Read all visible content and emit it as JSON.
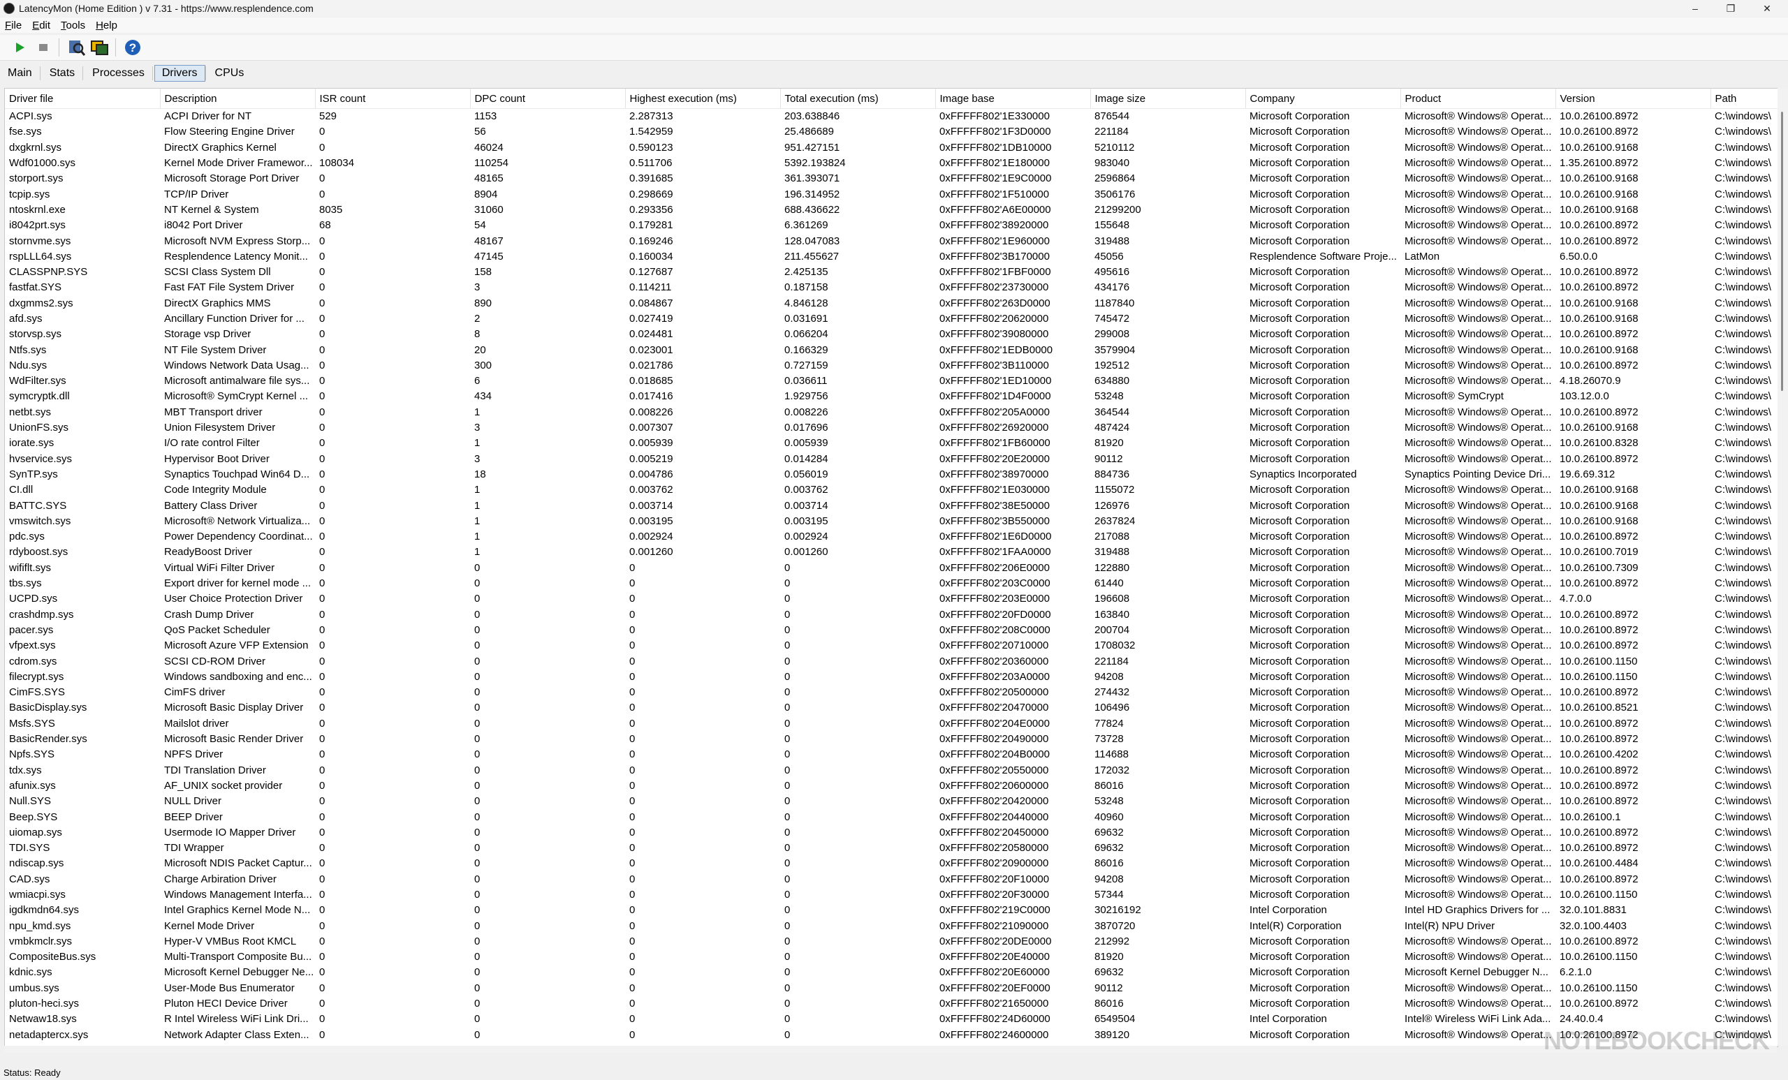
{
  "window": {
    "title": "LatencyMon  (Home Edition )  v 7.31 - https://www.resplendence.com",
    "minimize": "–",
    "maximize": "❐",
    "close": "✕"
  },
  "menu": [
    "File",
    "Edit",
    "Tools",
    "Help"
  ],
  "toolbar": {
    "buttons": [
      "play-icon",
      "stop-icon",
      "search-icon",
      "windows-icon",
      "help-icon"
    ],
    "colors": {
      "play": "#1aa32a",
      "stop": "#8a8a8a",
      "help": "#1f5fb8"
    }
  },
  "tabs": [
    "Main",
    "Stats",
    "Processes",
    "Drivers",
    "CPUs"
  ],
  "selected_tab": "Drivers",
  "columns": [
    "Driver file",
    "Description",
    "ISR count",
    "DPC count",
    "Highest execution (ms)",
    "Total execution (ms)",
    "Image base",
    "Image size",
    "Company",
    "Product",
    "Version",
    "Path"
  ],
  "rows": [
    [
      "ACPI.sys",
      "ACPI Driver for NT",
      "529",
      "1153",
      "2.287313",
      "203.638846",
      "0xFFFFF802'1E330000",
      "876544",
      "Microsoft Corporation",
      "Microsoft® Windows® Operat...",
      "10.0.26100.8972",
      "C:\\windows\\"
    ],
    [
      "fse.sys",
      "Flow Steering Engine Driver",
      "0",
      "56",
      "1.542959",
      "25.486689",
      "0xFFFFF802'1F3D0000",
      "221184",
      "Microsoft Corporation",
      "Microsoft® Windows® Operat...",
      "10.0.26100.8972",
      "C:\\windows\\"
    ],
    [
      "dxgkrnl.sys",
      "DirectX Graphics Kernel",
      "0",
      "46024",
      "0.590123",
      "951.427151",
      "0xFFFFF802'1DB10000",
      "5210112",
      "Microsoft Corporation",
      "Microsoft® Windows® Operat...",
      "10.0.26100.9168",
      "C:\\windows\\"
    ],
    [
      "Wdf01000.sys",
      "Kernel Mode Driver Framewor...",
      "108034",
      "110254",
      "0.511706",
      "5392.193824",
      "0xFFFFF802'1E180000",
      "983040",
      "Microsoft Corporation",
      "Microsoft® Windows® Operat...",
      "1.35.26100.8972",
      "C:\\windows\\"
    ],
    [
      "storport.sys",
      "Microsoft Storage Port Driver",
      "0",
      "48165",
      "0.391685",
      "361.393071",
      "0xFFFFF802'1E9C0000",
      "2596864",
      "Microsoft Corporation",
      "Microsoft® Windows® Operat...",
      "10.0.26100.9168",
      "C:\\windows\\"
    ],
    [
      "tcpip.sys",
      "TCP/IP Driver",
      "0",
      "8904",
      "0.298669",
      "196.314952",
      "0xFFFFF802'1F510000",
      "3506176",
      "Microsoft Corporation",
      "Microsoft® Windows® Operat...",
      "10.0.26100.9168",
      "C:\\windows\\"
    ],
    [
      "ntoskrnl.exe",
      "NT Kernel & System",
      "8035",
      "31060",
      "0.293356",
      "688.436622",
      "0xFFFFF802'A6E00000",
      "21299200",
      "Microsoft Corporation",
      "Microsoft® Windows® Operat...",
      "10.0.26100.9168",
      "C:\\windows\\"
    ],
    [
      "i8042prt.sys",
      "i8042 Port Driver",
      "68",
      "54",
      "0.179281",
      "6.361269",
      "0xFFFFF802'38920000",
      "155648",
      "Microsoft Corporation",
      "Microsoft® Windows® Operat...",
      "10.0.26100.8972",
      "C:\\windows\\"
    ],
    [
      "stornvme.sys",
      "Microsoft NVM Express Storp...",
      "0",
      "48167",
      "0.169246",
      "128.047083",
      "0xFFFFF802'1E960000",
      "319488",
      "Microsoft Corporation",
      "Microsoft® Windows® Operat...",
      "10.0.26100.8972",
      "C:\\windows\\"
    ],
    [
      "rspLLL64.sys",
      "Resplendence Latency Monit...",
      "0",
      "47145",
      "0.160034",
      "211.455627",
      "0xFFFFF802'3B170000",
      "45056",
      "Resplendence Software Proje...",
      "LatMon",
      "6.50.0.0",
      "C:\\windows\\"
    ],
    [
      "CLASSPNP.SYS",
      "SCSI Class System Dll",
      "0",
      "158",
      "0.127687",
      "2.425135",
      "0xFFFFF802'1FBF0000",
      "495616",
      "Microsoft Corporation",
      "Microsoft® Windows® Operat...",
      "10.0.26100.8972",
      "C:\\windows\\"
    ],
    [
      "fastfat.SYS",
      "Fast FAT File System Driver",
      "0",
      "3",
      "0.114211",
      "0.187158",
      "0xFFFFF802'23730000",
      "434176",
      "Microsoft Corporation",
      "Microsoft® Windows® Operat...",
      "10.0.26100.8972",
      "C:\\windows\\"
    ],
    [
      "dxgmms2.sys",
      "DirectX Graphics MMS",
      "0",
      "890",
      "0.084867",
      "4.846128",
      "0xFFFFF802'263D0000",
      "1187840",
      "Microsoft Corporation",
      "Microsoft® Windows® Operat...",
      "10.0.26100.9168",
      "C:\\windows\\"
    ],
    [
      "afd.sys",
      "Ancillary Function Driver for ...",
      "0",
      "2",
      "0.027419",
      "0.031691",
      "0xFFFFF802'20620000",
      "745472",
      "Microsoft Corporation",
      "Microsoft® Windows® Operat...",
      "10.0.26100.9168",
      "C:\\windows\\"
    ],
    [
      "storvsp.sys",
      "Storage vsp Driver",
      "0",
      "8",
      "0.024481",
      "0.066204",
      "0xFFFFF802'39080000",
      "299008",
      "Microsoft Corporation",
      "Microsoft® Windows® Operat...",
      "10.0.26100.8972",
      "C:\\windows\\"
    ],
    [
      "Ntfs.sys",
      "NT File System Driver",
      "0",
      "20",
      "0.023001",
      "0.166329",
      "0xFFFFF802'1EDB0000",
      "3579904",
      "Microsoft Corporation",
      "Microsoft® Windows® Operat...",
      "10.0.26100.9168",
      "C:\\windows\\"
    ],
    [
      "Ndu.sys",
      "Windows Network Data Usag...",
      "0",
      "300",
      "0.021786",
      "0.727159",
      "0xFFFFF802'3B110000",
      "192512",
      "Microsoft Corporation",
      "Microsoft® Windows® Operat...",
      "10.0.26100.8972",
      "C:\\windows\\"
    ],
    [
      "WdFilter.sys",
      "Microsoft antimalware file sys...",
      "0",
      "6",
      "0.018685",
      "0.036611",
      "0xFFFFF802'1ED10000",
      "634880",
      "Microsoft Corporation",
      "Microsoft® Windows® Operat...",
      "4.18.26070.9",
      "C:\\windows\\"
    ],
    [
      "symcryptk.dll",
      "Microsoft® SymCrypt Kernel ...",
      "0",
      "434",
      "0.017416",
      "1.929756",
      "0xFFFFF802'1D4F0000",
      "53248",
      "Microsoft Corporation",
      "Microsoft® SymCrypt",
      "103.12.0.0",
      "C:\\windows\\"
    ],
    [
      "netbt.sys",
      "MBT Transport driver",
      "0",
      "1",
      "0.008226",
      "0.008226",
      "0xFFFFF802'205A0000",
      "364544",
      "Microsoft Corporation",
      "Microsoft® Windows® Operat...",
      "10.0.26100.8972",
      "C:\\windows\\"
    ],
    [
      "UnionFS.sys",
      "Union Filesystem Driver",
      "0",
      "3",
      "0.007307",
      "0.017696",
      "0xFFFFF802'26920000",
      "487424",
      "Microsoft Corporation",
      "Microsoft® Windows® Operat...",
      "10.0.26100.9168",
      "C:\\windows\\"
    ],
    [
      "iorate.sys",
      "I/O rate control Filter",
      "0",
      "1",
      "0.005939",
      "0.005939",
      "0xFFFFF802'1FB60000",
      "81920",
      "Microsoft Corporation",
      "Microsoft® Windows® Operat...",
      "10.0.26100.8328",
      "C:\\windows\\"
    ],
    [
      "hvservice.sys",
      "Hypervisor Boot Driver",
      "0",
      "3",
      "0.005219",
      "0.014284",
      "0xFFFFF802'20E20000",
      "90112",
      "Microsoft Corporation",
      "Microsoft® Windows® Operat...",
      "10.0.26100.8972",
      "C:\\windows\\"
    ],
    [
      "SynTP.sys",
      "Synaptics Touchpad Win64 D...",
      "0",
      "18",
      "0.004786",
      "0.056019",
      "0xFFFFF802'38970000",
      "884736",
      "Synaptics Incorporated",
      "Synaptics Pointing Device Dri...",
      "19.6.69.312",
      "C:\\windows\\"
    ],
    [
      "CI.dll",
      "Code Integrity Module",
      "0",
      "1",
      "0.003762",
      "0.003762",
      "0xFFFFF802'1E030000",
      "1155072",
      "Microsoft Corporation",
      "Microsoft® Windows® Operat...",
      "10.0.26100.9168",
      "C:\\windows\\"
    ],
    [
      "BATTC.SYS",
      "Battery Class Driver",
      "0",
      "1",
      "0.003714",
      "0.003714",
      "0xFFFFF802'38E50000",
      "126976",
      "Microsoft Corporation",
      "Microsoft® Windows® Operat...",
      "10.0.26100.9168",
      "C:\\windows\\"
    ],
    [
      "vmswitch.sys",
      "Microsoft® Network Virtualiza...",
      "0",
      "1",
      "0.003195",
      "0.003195",
      "0xFFFFF802'3B550000",
      "2637824",
      "Microsoft Corporation",
      "Microsoft® Windows® Operat...",
      "10.0.26100.9168",
      "C:\\windows\\"
    ],
    [
      "pdc.sys",
      "Power Dependency Coordinat...",
      "0",
      "1",
      "0.002924",
      "0.002924",
      "0xFFFFF802'1E6D0000",
      "217088",
      "Microsoft Corporation",
      "Microsoft® Windows® Operat...",
      "10.0.26100.8972",
      "C:\\windows\\"
    ],
    [
      "rdyboost.sys",
      "ReadyBoost Driver",
      "0",
      "1",
      "0.001260",
      "0.001260",
      "0xFFFFF802'1FAA0000",
      "319488",
      "Microsoft Corporation",
      "Microsoft® Windows® Operat...",
      "10.0.26100.7019",
      "C:\\windows\\"
    ],
    [
      "wififlt.sys",
      "Virtual WiFi Filter Driver",
      "0",
      "0",
      "0",
      "0",
      "0xFFFFF802'206E0000",
      "122880",
      "Microsoft Corporation",
      "Microsoft® Windows® Operat...",
      "10.0.26100.7309",
      "C:\\windows\\"
    ],
    [
      "tbs.sys",
      "Export driver for kernel mode ...",
      "0",
      "0",
      "0",
      "0",
      "0xFFFFF802'203C0000",
      "61440",
      "Microsoft Corporation",
      "Microsoft® Windows® Operat...",
      "10.0.26100.8972",
      "C:\\windows\\"
    ],
    [
      "UCPD.sys",
      "User Choice Protection Driver",
      "0",
      "0",
      "0",
      "0",
      "0xFFFFF802'203E0000",
      "196608",
      "Microsoft Corporation",
      "Microsoft® Windows® Operat...",
      "4.7.0.0",
      "C:\\windows\\"
    ],
    [
      "crashdmp.sys",
      "Crash Dump Driver",
      "0",
      "0",
      "0",
      "0",
      "0xFFFFF802'20FD0000",
      "163840",
      "Microsoft Corporation",
      "Microsoft® Windows® Operat...",
      "10.0.26100.8972",
      "C:\\windows\\"
    ],
    [
      "pacer.sys",
      "QoS Packet Scheduler",
      "0",
      "0",
      "0",
      "0",
      "0xFFFFF802'208C0000",
      "200704",
      "Microsoft Corporation",
      "Microsoft® Windows® Operat...",
      "10.0.26100.8972",
      "C:\\windows\\"
    ],
    [
      "vfpext.sys",
      "Microsoft Azure VFP Extension",
      "0",
      "0",
      "0",
      "0",
      "0xFFFFF802'20710000",
      "1708032",
      "Microsoft Corporation",
      "Microsoft® Windows® Operat...",
      "10.0.26100.8972",
      "C:\\windows\\"
    ],
    [
      "cdrom.sys",
      "SCSI CD-ROM Driver",
      "0",
      "0",
      "0",
      "0",
      "0xFFFFF802'20360000",
      "221184",
      "Microsoft Corporation",
      "Microsoft® Windows® Operat...",
      "10.0.26100.1150",
      "C:\\windows\\"
    ],
    [
      "filecrypt.sys",
      "Windows sandboxing and enc...",
      "0",
      "0",
      "0",
      "0",
      "0xFFFFF802'203A0000",
      "94208",
      "Microsoft Corporation",
      "Microsoft® Windows® Operat...",
      "10.0.26100.1150",
      "C:\\windows\\"
    ],
    [
      "CimFS.SYS",
      "CimFS driver",
      "0",
      "0",
      "0",
      "0",
      "0xFFFFF802'20500000",
      "274432",
      "Microsoft Corporation",
      "Microsoft® Windows® Operat...",
      "10.0.26100.8972",
      "C:\\windows\\"
    ],
    [
      "BasicDisplay.sys",
      "Microsoft Basic Display Driver",
      "0",
      "0",
      "0",
      "0",
      "0xFFFFF802'20470000",
      "106496",
      "Microsoft Corporation",
      "Microsoft® Windows® Operat...",
      "10.0.26100.8521",
      "C:\\windows\\"
    ],
    [
      "Msfs.SYS",
      "Mailslot driver",
      "0",
      "0",
      "0",
      "0",
      "0xFFFFF802'204E0000",
      "77824",
      "Microsoft Corporation",
      "Microsoft® Windows® Operat...",
      "10.0.26100.8972",
      "C:\\windows\\"
    ],
    [
      "BasicRender.sys",
      "Microsoft Basic Render Driver",
      "0",
      "0",
      "0",
      "0",
      "0xFFFFF802'20490000",
      "73728",
      "Microsoft Corporation",
      "Microsoft® Windows® Operat...",
      "10.0.26100.8972",
      "C:\\windows\\"
    ],
    [
      "Npfs.SYS",
      "NPFS Driver",
      "0",
      "0",
      "0",
      "0",
      "0xFFFFF802'204B0000",
      "114688",
      "Microsoft Corporation",
      "Microsoft® Windows® Operat...",
      "10.0.26100.4202",
      "C:\\windows\\"
    ],
    [
      "tdx.sys",
      "TDI Translation Driver",
      "0",
      "0",
      "0",
      "0",
      "0xFFFFF802'20550000",
      "172032",
      "Microsoft Corporation",
      "Microsoft® Windows® Operat...",
      "10.0.26100.8972",
      "C:\\windows\\"
    ],
    [
      "afunix.sys",
      "AF_UNIX socket provider",
      "0",
      "0",
      "0",
      "0",
      "0xFFFFF802'20600000",
      "86016",
      "Microsoft Corporation",
      "Microsoft® Windows® Operat...",
      "10.0.26100.8972",
      "C:\\windows\\"
    ],
    [
      "Null.SYS",
      "NULL Driver",
      "0",
      "0",
      "0",
      "0",
      "0xFFFFF802'20420000",
      "53248",
      "Microsoft Corporation",
      "Microsoft® Windows® Operat...",
      "10.0.26100.8972",
      "C:\\windows\\"
    ],
    [
      "Beep.SYS",
      "BEEP Driver",
      "0",
      "0",
      "0",
      "0",
      "0xFFFFF802'20440000",
      "40960",
      "Microsoft Corporation",
      "Microsoft® Windows® Operat...",
      "10.0.26100.1",
      "C:\\windows\\"
    ],
    [
      "uiomap.sys",
      "Usermode IO Mapper Driver",
      "0",
      "0",
      "0",
      "0",
      "0xFFFFF802'20450000",
      "69632",
      "Microsoft Corporation",
      "Microsoft® Windows® Operat...",
      "10.0.26100.8972",
      "C:\\windows\\"
    ],
    [
      "TDI.SYS",
      "TDI Wrapper",
      "0",
      "0",
      "0",
      "0",
      "0xFFFFF802'20580000",
      "69632",
      "Microsoft Corporation",
      "Microsoft® Windows® Operat...",
      "10.0.26100.8972",
      "C:\\windows\\"
    ],
    [
      "ndiscap.sys",
      "Microsoft NDIS Packet Captur...",
      "0",
      "0",
      "0",
      "0",
      "0xFFFFF802'20900000",
      "86016",
      "Microsoft Corporation",
      "Microsoft® Windows® Operat...",
      "10.0.26100.4484",
      "C:\\windows\\"
    ],
    [
      "CAD.sys",
      "Charge Arbiration Driver",
      "0",
      "0",
      "0",
      "0",
      "0xFFFFF802'20F10000",
      "94208",
      "Microsoft Corporation",
      "Microsoft® Windows® Operat...",
      "10.0.26100.8972",
      "C:\\windows\\"
    ],
    [
      "wmiacpi.sys",
      "Windows Management Interfa...",
      "0",
      "0",
      "0",
      "0",
      "0xFFFFF802'20F30000",
      "57344",
      "Microsoft Corporation",
      "Microsoft® Windows® Operat...",
      "10.0.26100.1150",
      "C:\\windows\\"
    ],
    [
      "igdkmdn64.sys",
      "Intel Graphics Kernel Mode N...",
      "0",
      "0",
      "0",
      "0",
      "0xFFFFF802'219C0000",
      "30216192",
      "Intel Corporation",
      "Intel HD Graphics Drivers for ...",
      "32.0.101.8831",
      "C:\\windows\\"
    ],
    [
      "npu_kmd.sys",
      "Kernel Mode Driver",
      "0",
      "0",
      "0",
      "0",
      "0xFFFFF802'21090000",
      "3870720",
      "Intel(R) Corporation",
      "Intel(R) NPU Driver",
      "32.0.100.4403",
      "C:\\windows\\"
    ],
    [
      "vmbkmclr.sys",
      "Hyper-V VMBus Root KMCL",
      "0",
      "0",
      "0",
      "0",
      "0xFFFFF802'20DE0000",
      "212992",
      "Microsoft Corporation",
      "Microsoft® Windows® Operat...",
      "10.0.26100.8972",
      "C:\\windows\\"
    ],
    [
      "CompositeBus.sys",
      "Multi-Transport Composite Bu...",
      "0",
      "0",
      "0",
      "0",
      "0xFFFFF802'20E40000",
      "81920",
      "Microsoft Corporation",
      "Microsoft® Windows® Operat...",
      "10.0.26100.1150",
      "C:\\windows\\"
    ],
    [
      "kdnic.sys",
      "Microsoft Kernel Debugger Ne...",
      "0",
      "0",
      "0",
      "0",
      "0xFFFFF802'20E60000",
      "69632",
      "Microsoft Corporation",
      "Microsoft Kernel Debugger N...",
      "6.2.1.0",
      "C:\\windows\\"
    ],
    [
      "umbus.sys",
      "User-Mode Bus Enumerator",
      "0",
      "0",
      "0",
      "0",
      "0xFFFFF802'20EF0000",
      "90112",
      "Microsoft Corporation",
      "Microsoft® Windows® Operat...",
      "10.0.26100.1150",
      "C:\\windows\\"
    ],
    [
      "pluton-heci.sys",
      "Pluton HECI Device Driver",
      "0",
      "0",
      "0",
      "0",
      "0xFFFFF802'21650000",
      "86016",
      "Microsoft Corporation",
      "Microsoft® Windows® Operat...",
      "10.0.26100.8972",
      "C:\\windows\\"
    ],
    [
      "Netwaw18.sys",
      "R Intel Wireless WiFi Link Dri...",
      "0",
      "0",
      "0",
      "0",
      "0xFFFFF802'24D60000",
      "6549504",
      "Intel Corporation",
      "Intel® Wireless WiFi Link Ada...",
      "24.40.0.4",
      "C:\\windows\\"
    ],
    [
      "netadaptercx.sys",
      "Network Adapter Class Exten...",
      "0",
      "0",
      "0",
      "0",
      "0xFFFFF802'24600000",
      "389120",
      "Microsoft Corporation",
      "Microsoft® Windows® Operat...",
      "10.0.26100.8972",
      "C:\\windows\\"
    ]
  ],
  "status": "Status: Ready",
  "watermark": "NOTEBOOKCHECK"
}
